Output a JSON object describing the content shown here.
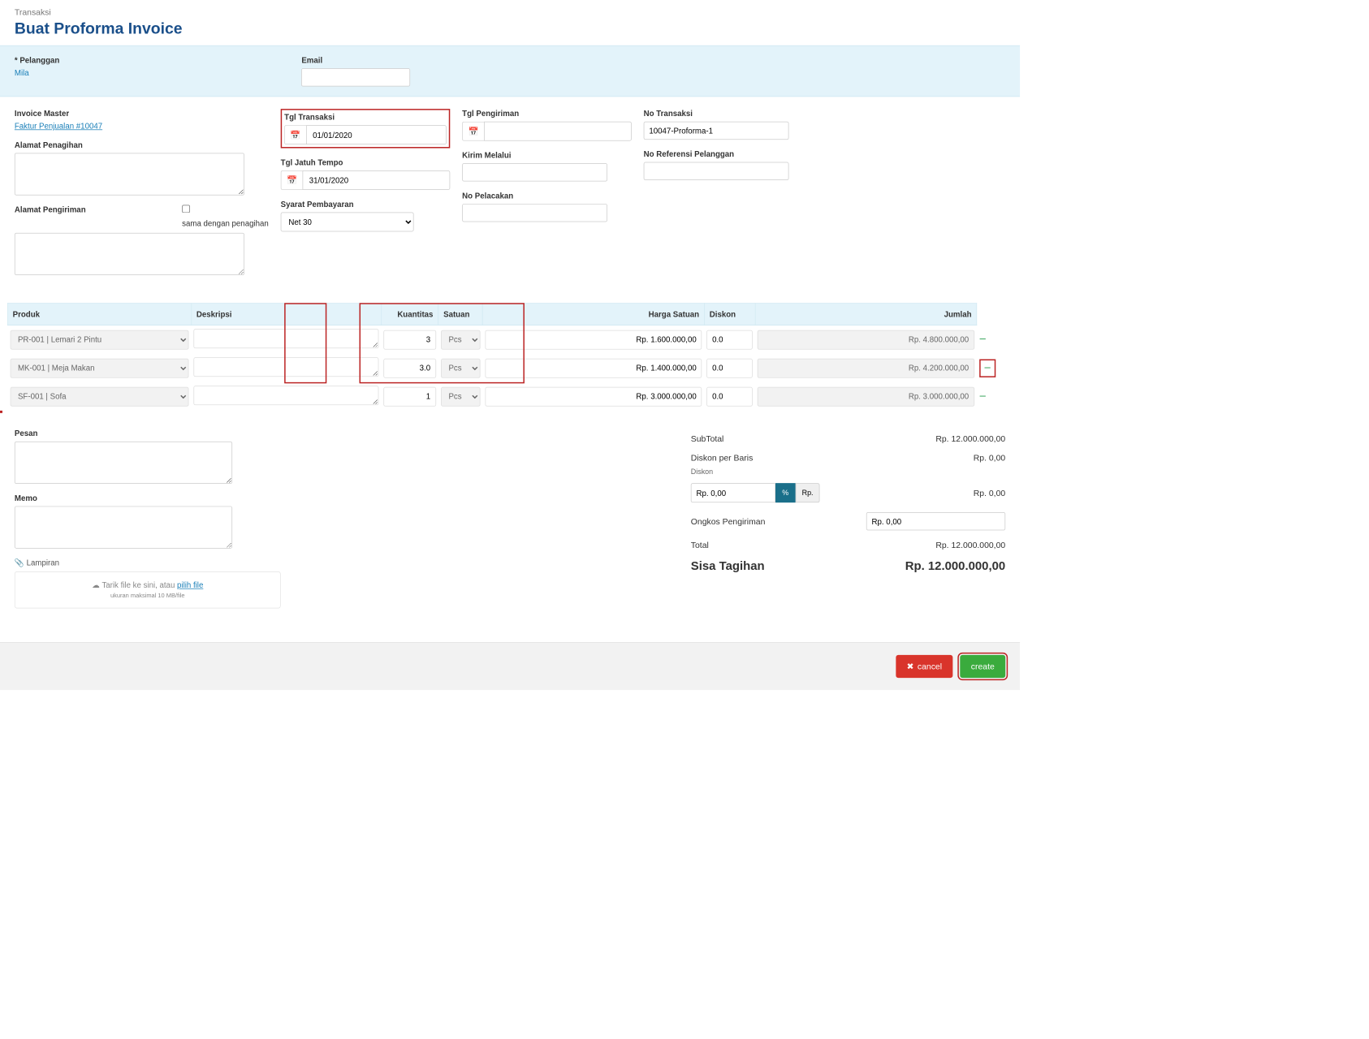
{
  "header": {
    "breadcrumb": "Transaksi",
    "title": "Buat Proforma Invoice"
  },
  "customer": {
    "pelanggan_label": "* Pelanggan",
    "pelanggan_value": "Mila",
    "email_label": "Email",
    "email_value": ""
  },
  "form": {
    "invoice_master_label": "Invoice Master",
    "invoice_master_link": "Faktur Penjualan #10047",
    "alamat_penagihan_label": "Alamat Penagihan",
    "alamat_penagihan_value": "",
    "alamat_pengiriman_label": "Alamat Pengiriman",
    "sama_dengan_label": "sama dengan penagihan",
    "tgl_transaksi_label": "Tgl Transaksi",
    "tgl_transaksi_value": "01/01/2020",
    "tgl_jatuh_tempo_label": "Tgl Jatuh Tempo",
    "tgl_jatuh_tempo_value": "31/01/2020",
    "syarat_label": "Syarat Pembayaran",
    "syarat_value": "Net 30",
    "tgl_pengiriman_label": "Tgl Pengiriman",
    "tgl_pengiriman_value": "",
    "kirim_melalui_label": "Kirim Melalui",
    "kirim_melalui_value": "",
    "no_pelacakan_label": "No Pelacakan",
    "no_pelacakan_value": "",
    "no_transaksi_label": "No Transaksi",
    "no_transaksi_value": "10047-Proforma-1",
    "no_ref_label": "No Referensi Pelanggan",
    "no_ref_value": ""
  },
  "table": {
    "col_produk": "Produk",
    "col_deskripsi": "Deskripsi",
    "col_kuantitas": "Kuantitas",
    "col_satuan": "Satuan",
    "col_harga": "Harga Satuan",
    "col_diskon": "Diskon",
    "col_jumlah": "Jumlah",
    "rows": [
      {
        "produk": "PR-001 | Lemari 2 Pintu",
        "desc": "",
        "qty": "3",
        "unit": "Pcs",
        "harga": "Rp. 1.600.000,00",
        "diskon": "0.0",
        "jumlah": "Rp. 4.800.000,00"
      },
      {
        "produk": "MK-001 | Meja Makan",
        "desc": "",
        "qty": "3.0",
        "unit": "Pcs",
        "harga": "Rp. 1.400.000,00",
        "diskon": "0.0",
        "jumlah": "Rp. 4.200.000,00"
      },
      {
        "produk": "SF-001 | Sofa",
        "desc": "",
        "qty": "1",
        "unit": "Pcs",
        "harga": "Rp. 3.000.000,00",
        "diskon": "0.0",
        "jumlah": "Rp. 3.000.000,00"
      }
    ]
  },
  "notes": {
    "pesan_label": "Pesan",
    "memo_label": "Memo",
    "lampiran_label": "Lampiran",
    "drop_text": "Tarik file ke sini, atau ",
    "drop_link": "pilih file",
    "drop_hint": "ukuran maksimal 10 MB/file"
  },
  "totals": {
    "subtotal_label": "SubTotal",
    "subtotal_value": "Rp. 12.000.000,00",
    "diskon_baris_label": "Diskon per Baris",
    "diskon_baris_value": "Rp. 0,00",
    "diskon_label": "Diskon",
    "diskon_input": "Rp. 0,00",
    "diskon_pct": "%",
    "diskon_rp": "Rp.",
    "diskon_value": "Rp. 0,00",
    "ongkos_label": "Ongkos Pengiriman",
    "ongkos_input": "Rp. 0,00",
    "total_label": "Total",
    "total_value": "Rp. 12.000.000,00",
    "sisa_label": "Sisa Tagihan",
    "sisa_value": "Rp. 12.000.000,00"
  },
  "footer": {
    "cancel": "cancel",
    "create": "create"
  }
}
